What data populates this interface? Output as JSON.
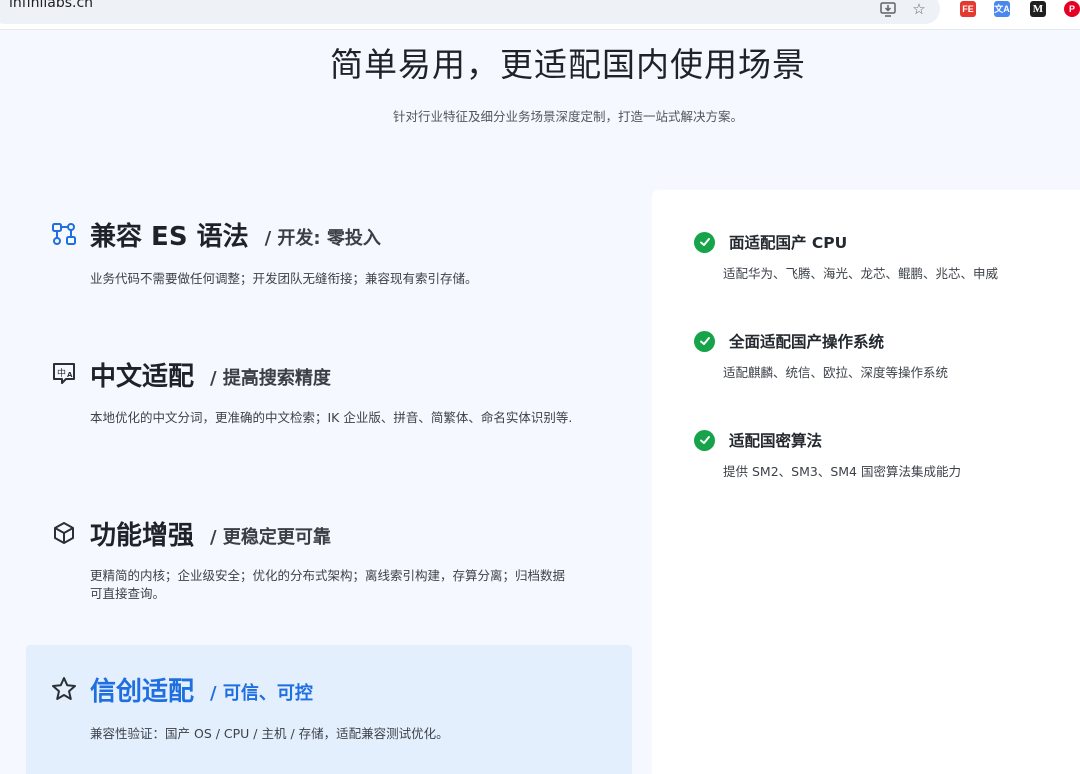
{
  "browser": {
    "url": "infinilabs.cn",
    "icons": [
      "site-info-icon",
      "install-app-icon",
      "star-icon"
    ],
    "extensions": [
      "FE",
      "文A",
      "M",
      "P"
    ]
  },
  "header": {
    "title": "简单易用，更适配国内使用场景",
    "subtitle": "针对行业特征及细分业务场景深度定制，打造一站式解决方案。"
  },
  "features": [
    {
      "icon": "api-nodes-icon",
      "title": "兼容 ES 语法",
      "tag": "/ 开发: 零投入",
      "desc": "业务代码不需要做任何调整；开发团队无缝衔接；兼容现有索引存储。"
    },
    {
      "icon": "chinese-lang-icon",
      "title": "中文适配",
      "tag": "/ 提高搜索精度",
      "desc": "本地优化的中文分词，更准确的中文检索；IK 企业版、拼音、简繁体、命名实体识别等."
    },
    {
      "icon": "cube-icon",
      "title": "功能增强",
      "tag": "/ 更稳定更可靠",
      "desc": "更精简的内核；企业级安全；优化的分布式架构；离线索引构建，存算分离；归档数据可直接查询。"
    },
    {
      "icon": "star-outline-icon",
      "title": "信创适配",
      "tag": "/ 可信、可控",
      "desc": "兼容性验证：国产 OS / CPU / 主机 / 存储，适配兼容测试优化。",
      "active": true
    }
  ],
  "adaptations": [
    {
      "title": "面适配国产 CPU",
      "desc": "适配华为、飞腾、海光、龙芯、鲲鹏、兆芯、申威"
    },
    {
      "title": "全面适配国产操作系统",
      "desc": "适配麒麟、统信、欧拉、深度等操作系统"
    },
    {
      "title": "适配国密算法",
      "desc": "提供 SM2、SM3、SM4 国密算法集成能力"
    }
  ],
  "colors": {
    "accent": "#1f6fe0",
    "check": "#17a34a",
    "active_bg": "#e4effd"
  }
}
